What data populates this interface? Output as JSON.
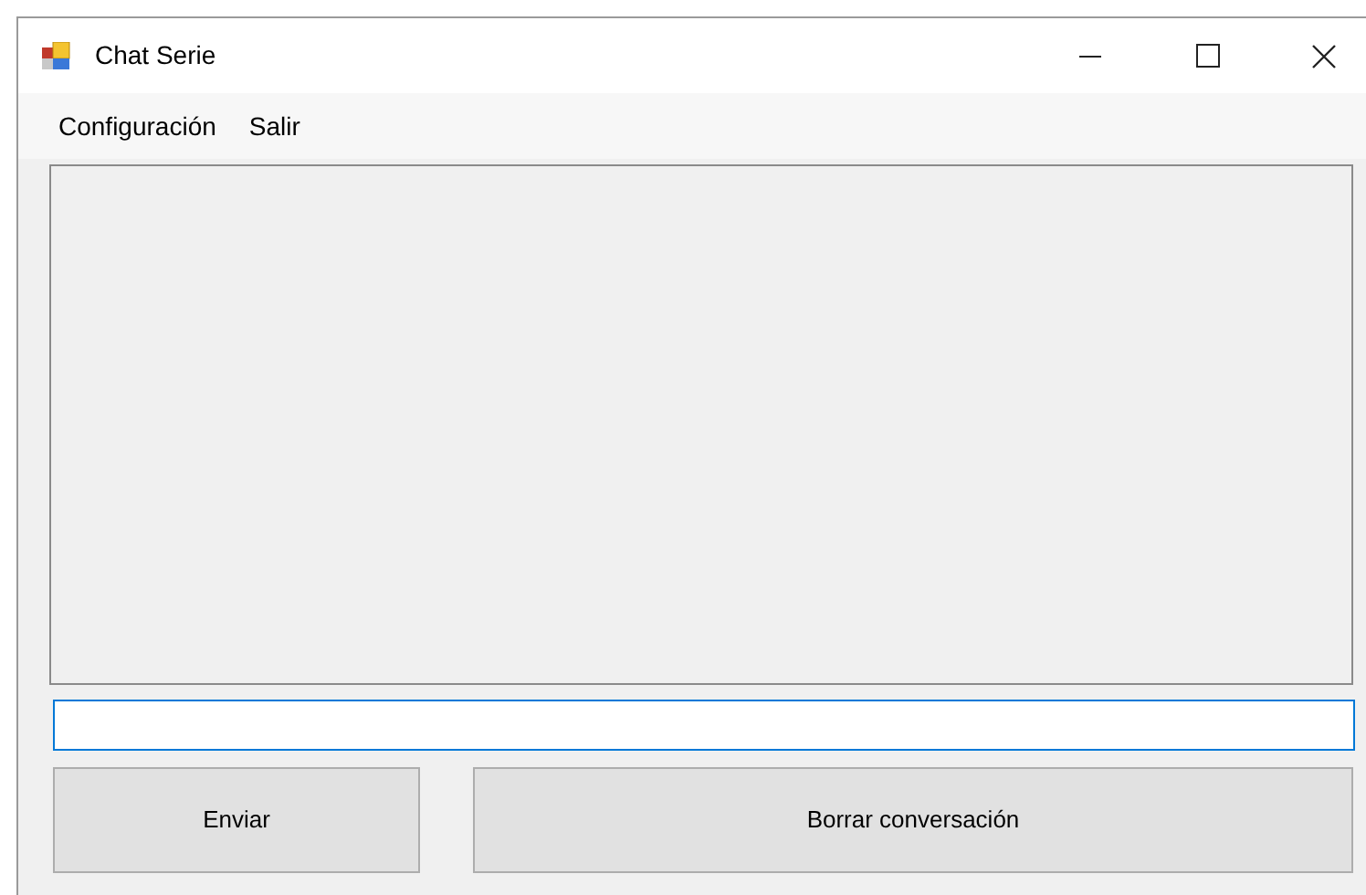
{
  "window": {
    "title": "Chat Serie"
  },
  "menu": [
    "Configuración",
    "Salir"
  ],
  "message_field": {
    "focused": true
  },
  "buttons": [
    {
      "label": "Enviar"
    },
    {
      "label": "Borrar conversación"
    }
  ]
}
